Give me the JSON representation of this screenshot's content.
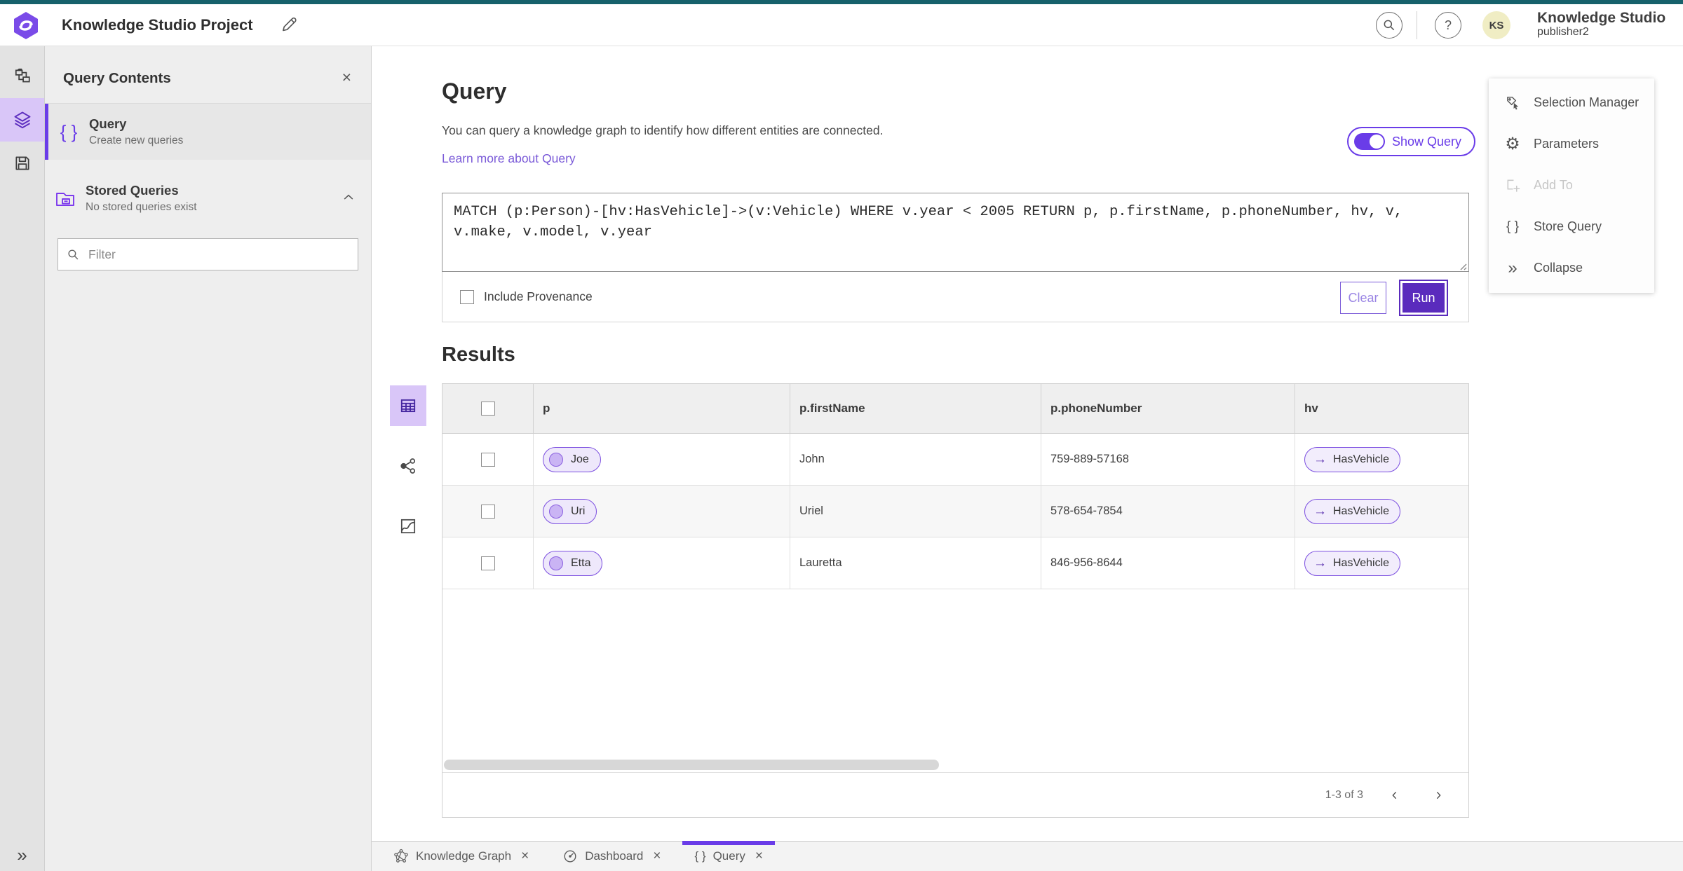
{
  "topbar": {
    "project_title": "Knowledge Studio Project",
    "app_name": "Knowledge Studio",
    "username": "publisher2",
    "avatar_initials": "KS"
  },
  "contents_panel": {
    "title": "Query Contents",
    "query_item": {
      "label": "Query",
      "description": "Create new queries"
    },
    "stored_item": {
      "label": "Stored Queries",
      "description": "No stored queries exist"
    },
    "filter_placeholder": "Filter"
  },
  "query_panel": {
    "heading": "Query",
    "description": "You can query a knowledge graph to identify how different entities are connected.",
    "learn_more": "Learn more about Query",
    "show_query_label": "Show Query",
    "query_text": "MATCH (p:Person)-[hv:HasVehicle]->(v:Vehicle) WHERE v.year < 2005 RETURN p, p.firstName, p.phoneNumber, hv, v, v.make, v.model, v.year",
    "include_provenance_label": "Include Provenance",
    "clear_label": "Clear",
    "run_label": "Run"
  },
  "results": {
    "heading": "Results",
    "columns": [
      "p",
      "p.firstName",
      "p.phoneNumber",
      "hv"
    ],
    "rows": [
      {
        "p": "Joe",
        "firstName": "John",
        "phone": "759-889-57168",
        "hv": "HasVehicle"
      },
      {
        "p": "Uri",
        "firstName": "Uriel",
        "phone": "578-654-7854",
        "hv": "HasVehicle"
      },
      {
        "p": "Etta",
        "firstName": "Lauretta",
        "phone": "846-956-8644",
        "hv": "HasVehicle"
      }
    ],
    "range_label": "1-3 of 3"
  },
  "tools_menu": {
    "items": [
      {
        "label": "Selection Manager"
      },
      {
        "label": "Parameters"
      },
      {
        "label": "Add To"
      },
      {
        "label": "Store Query"
      },
      {
        "label": "Collapse"
      }
    ]
  },
  "tabs": [
    {
      "label": "Knowledge Graph"
    },
    {
      "label": "Dashboard"
    },
    {
      "label": "Query"
    }
  ],
  "glyphs": {
    "braces": "{ }",
    "close": "×",
    "collapse": "»",
    "arrow_right": "→",
    "help": "?",
    "gear": "⚙"
  },
  "colors": {
    "accent_purple": "#6a3ce8",
    "run_button_purple": "#5a2bbd",
    "top_strip_teal": "#17616b",
    "active_icon_background": "#d9c6f8",
    "pill_border_purple": "#7c4fe0",
    "avatar_yellow": "#f0edc4"
  }
}
